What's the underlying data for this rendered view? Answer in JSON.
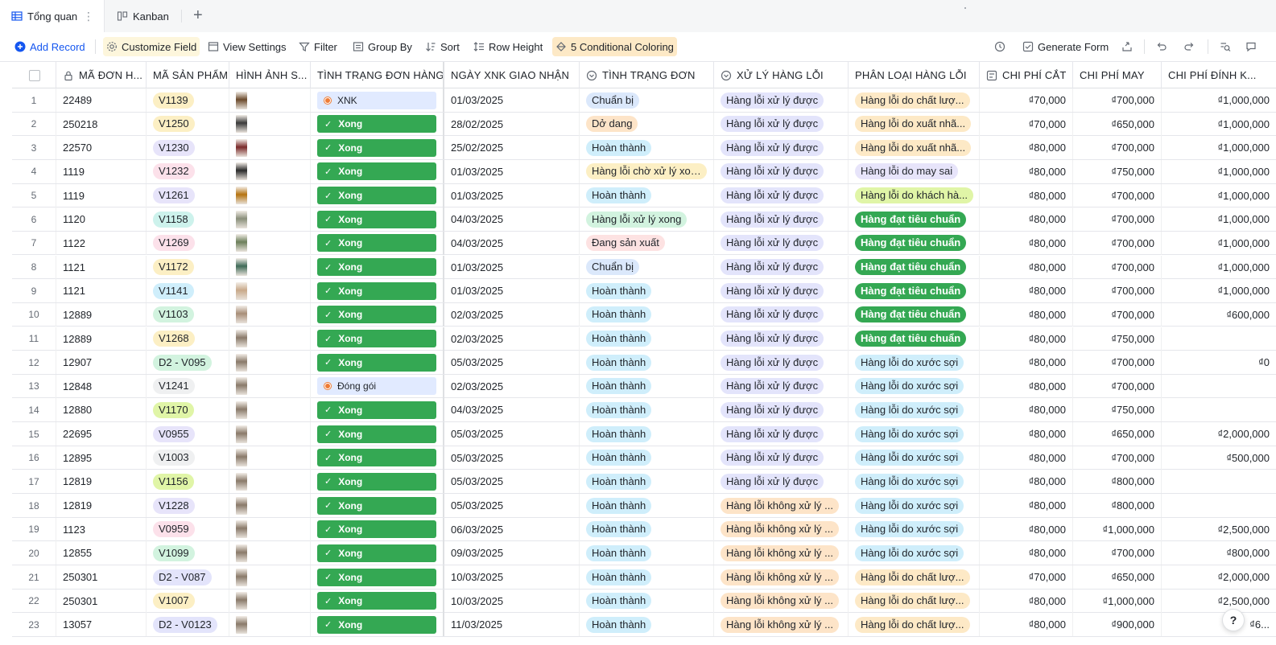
{
  "tabs": [
    {
      "label": "Tổng quan",
      "active": true
    },
    {
      "label": "Kanban",
      "active": false
    }
  ],
  "toolbar": {
    "add_record": "Add Record",
    "customize_field": "Customize Field",
    "view_settings": "View Settings",
    "filter": "Filter",
    "group_by": "Group By",
    "sort": "Sort",
    "row_height": "Row Height",
    "conditional_coloring": "5 Conditional Coloring",
    "generate_form": "Generate Form"
  },
  "columns": [
    "MÃ ĐƠN H...",
    "MÃ SẢN PHẨM",
    "HÌNH ẢNH S...",
    "TÌNH TRẠNG ĐƠN HÀNG",
    "NGÀY XNK GIAO NHẬN",
    "TÌNH TRẠNG ĐƠN",
    "XỬ LÝ HÀNG LỖI",
    "PHÂN LOẠI HÀNG LỖI",
    "CHI PHÍ CẮT",
    "CHI PHÍ MAY",
    "CHI PHÍ ĐÍNH K..."
  ],
  "colors": {
    "done_green": "#34a853",
    "accent_blue": "#1456f0"
  },
  "rows": [
    {
      "n": "1",
      "order": "22489",
      "product": "V1139",
      "pc": "#fcefc4",
      "img": "#6b4a2b",
      "status": "XNK",
      "date": "01/03/2025",
      "os": "Chuẩn bị",
      "osc": "#dbe8fb",
      "xl": "Hàng lỗi xử lý được",
      "xlc": "#e3e4fb",
      "pl": "Hàng lỗi do chất lượ...",
      "plc": "#fde9c6",
      "cut": "₫70,000",
      "sew": "₫700,000",
      "att": "₫1,000,000"
    },
    {
      "n": "2",
      "order": "250218",
      "product": "V1250",
      "pc": "#fcefc4",
      "img": "#3a3a3a",
      "status": "Xong",
      "date": "28/02/2025",
      "os": "Dở dang",
      "osc": "#fde4c8",
      "xl": "Hàng lỗi xử lý được",
      "xlc": "#e3e4fb",
      "pl": "Hàng lỗi do xuất nhã...",
      "plc": "#fde9c6",
      "cut": "₫70,000",
      "sew": "₫650,000",
      "att": "₫1,000,000"
    },
    {
      "n": "3",
      "order": "22570",
      "product": "V1230",
      "pc": "#e7e4fa",
      "img": "#7a2a2a",
      "status": "Xong",
      "date": "25/02/2025",
      "os": "Hoàn thành",
      "osc": "#cfeefb",
      "xl": "Hàng lỗi xử lý được",
      "xlc": "#e3e4fb",
      "pl": "Hàng lỗi do xuất nhã...",
      "plc": "#fde9c6",
      "cut": "₫80,000",
      "sew": "₫700,000",
      "att": "₫1,000,000"
    },
    {
      "n": "4",
      "order": "1119",
      "product": "V1232",
      "pc": "#fce1ea",
      "img": "#2a2a2a",
      "status": "Xong",
      "date": "01/03/2025",
      "os": "Hàng lỗi chờ xử lý xong",
      "osc": "#fcefc4",
      "xl": "Hàng lỗi xử lý được",
      "xlc": "#e3e4fb",
      "pl": "Hàng lỗi do may sai",
      "plc": "#e7e4fa",
      "cut": "₫80,000",
      "sew": "₫750,000",
      "att": "₫1,000,000"
    },
    {
      "n": "5",
      "order": "1119",
      "product": "V1261",
      "pc": "#e7e4fa",
      "img": "#b5730f",
      "status": "Xong",
      "date": "01/03/2025",
      "os": "Hoàn thành",
      "osc": "#cfeefb",
      "xl": "Hàng lỗi xử lý được",
      "xlc": "#e3e4fb",
      "pl": "Hàng lỗi do khách hà...",
      "plc": "#e0f5a7",
      "cut": "₫80,000",
      "sew": "₫700,000",
      "att": "₫1,000,000"
    },
    {
      "n": "6",
      "order": "1120",
      "product": "V1158",
      "pc": "#cdf2ec",
      "img": "#8a8f7a",
      "status": "Xong",
      "date": "04/03/2025",
      "os": "Hàng lỗi xử lý xong",
      "osc": "#d2f3df",
      "xl": "Hàng lỗi xử lý được",
      "xlc": "#e3e4fb",
      "pl": "Hàng đạt tiêu chuẩn",
      "plc": "done",
      "cut": "₫80,000",
      "sew": "₫700,000",
      "att": "₫1,000,000"
    },
    {
      "n": "7",
      "order": "1122",
      "product": "V1269",
      "pc": "#fce1ea",
      "img": "#6c7f5a",
      "status": "Xong",
      "date": "04/03/2025",
      "os": "Đang sản xuất",
      "osc": "#fde2e2",
      "xl": "Hàng lỗi xử lý được",
      "xlc": "#e3e4fb",
      "pl": "Hàng đạt tiêu chuẩn",
      "plc": "done",
      "cut": "₫80,000",
      "sew": "₫700,000",
      "att": "₫1,000,000"
    },
    {
      "n": "8",
      "order": "1121",
      "product": "V1172",
      "pc": "#fcefc4",
      "img": "#3f6b58",
      "status": "Xong",
      "date": "01/03/2025",
      "os": "Chuẩn bị",
      "osc": "#dbe8fb",
      "xl": "Hàng lỗi xử lý được",
      "xlc": "#e3e4fb",
      "pl": "Hàng đạt tiêu chuẩn",
      "plc": "done",
      "cut": "₫80,000",
      "sew": "₫700,000",
      "att": "₫1,000,000"
    },
    {
      "n": "9",
      "order": "1121",
      "product": "V1141",
      "pc": "#cfeefb",
      "img": "#c9a98a",
      "status": "Xong",
      "date": "01/03/2025",
      "os": "Hoàn thành",
      "osc": "#cfeefb",
      "xl": "Hàng lỗi xử lý được",
      "xlc": "#e3e4fb",
      "pl": "Hàng đạt tiêu chuẩn",
      "plc": "done",
      "cut": "₫80,000",
      "sew": "₫700,000",
      "att": "₫1,000,000"
    },
    {
      "n": "10",
      "order": "12889",
      "product": "V1103",
      "pc": "#d2f3df",
      "img": "#a88e78",
      "status": "Xong",
      "date": "02/03/2025",
      "os": "Hoàn thành",
      "osc": "#cfeefb",
      "xl": "Hàng lỗi xử lý được",
      "xlc": "#e3e4fb",
      "pl": "Hàng đạt tiêu chuẩn",
      "plc": "done",
      "cut": "₫80,000",
      "sew": "₫700,000",
      "att": "₫600,000"
    },
    {
      "n": "11",
      "order": "12889",
      "product": "V1268",
      "pc": "#fcefc4",
      "img": "#8a7a6a",
      "status": "Xong",
      "date": "02/03/2025",
      "os": "Hoàn thành",
      "osc": "#cfeefb",
      "xl": "Hàng lỗi xử lý được",
      "xlc": "#e3e4fb",
      "pl": "Hàng đạt tiêu chuẩn",
      "plc": "done",
      "cut": "₫80,000",
      "sew": "₫750,000",
      "att": ""
    },
    {
      "n": "12",
      "order": "12907",
      "product": "D2 - V095",
      "pc": "#d2f3df",
      "img": "#8a7a6a",
      "status": "Xong",
      "date": "05/03/2025",
      "os": "Hoàn thành",
      "osc": "#cfeefb",
      "xl": "Hàng lỗi xử lý được",
      "xlc": "#e3e4fb",
      "pl": "Hàng lỗi do xước sợi",
      "plc": "#cfeefb",
      "cut": "₫80,000",
      "sew": "₫700,000",
      "att": "₫0"
    },
    {
      "n": "13",
      "order": "12848",
      "product": "V1241",
      "pc": "#eff0f1",
      "img": "#8a7a6a",
      "status": "Đóng gói",
      "date": "02/03/2025",
      "os": "Hoàn thành",
      "osc": "#cfeefb",
      "xl": "Hàng lỗi xử lý được",
      "xlc": "#e3e4fb",
      "pl": "Hàng lỗi do xước sợi",
      "plc": "#cfeefb",
      "cut": "₫80,000",
      "sew": "₫700,000",
      "att": ""
    },
    {
      "n": "14",
      "order": "12880",
      "product": "V1170",
      "pc": "#e0f5a7",
      "img": "#8a7a6a",
      "status": "Xong",
      "date": "04/03/2025",
      "os": "Hoàn thành",
      "osc": "#cfeefb",
      "xl": "Hàng lỗi xử lý được",
      "xlc": "#e3e4fb",
      "pl": "Hàng lỗi do xước sợi",
      "plc": "#cfeefb",
      "cut": "₫80,000",
      "sew": "₫750,000",
      "att": ""
    },
    {
      "n": "15",
      "order": "22695",
      "product": "V0955",
      "pc": "#e7e4fa",
      "img": "#8a7a6a",
      "status": "Xong",
      "date": "05/03/2025",
      "os": "Hoàn thành",
      "osc": "#cfeefb",
      "xl": "Hàng lỗi xử lý được",
      "xlc": "#e3e4fb",
      "pl": "Hàng lỗi do xước sợi",
      "plc": "#cfeefb",
      "cut": "₫80,000",
      "sew": "₫650,000",
      "att": "₫2,000,000"
    },
    {
      "n": "16",
      "order": "12895",
      "product": "V1003",
      "pc": "#eff0f1",
      "img": "#8a7a6a",
      "status": "Xong",
      "date": "05/03/2025",
      "os": "Hoàn thành",
      "osc": "#cfeefb",
      "xl": "Hàng lỗi xử lý được",
      "xlc": "#e3e4fb",
      "pl": "Hàng lỗi do xước sợi",
      "plc": "#cfeefb",
      "cut": "₫80,000",
      "sew": "₫700,000",
      "att": "₫500,000"
    },
    {
      "n": "17",
      "order": "12819",
      "product": "V1156",
      "pc": "#e0f5a7",
      "img": "#8a7a6a",
      "status": "Xong",
      "date": "05/03/2025",
      "os": "Hoàn thành",
      "osc": "#cfeefb",
      "xl": "Hàng lỗi xử lý được",
      "xlc": "#e3e4fb",
      "pl": "Hàng lỗi do xước sợi",
      "plc": "#cfeefb",
      "cut": "₫80,000",
      "sew": "₫800,000",
      "att": ""
    },
    {
      "n": "18",
      "order": "12819",
      "product": "V1228",
      "pc": "#e7e4fa",
      "img": "#8a7a6a",
      "status": "Xong",
      "date": "05/03/2025",
      "os": "Hoàn thành",
      "osc": "#cfeefb",
      "xl": "Hàng lỗi không xử lý ...",
      "xlc": "#fde4c8",
      "pl": "Hàng lỗi do xước sợi",
      "plc": "#cfeefb",
      "cut": "₫80,000",
      "sew": "₫800,000",
      "att": ""
    },
    {
      "n": "19",
      "order": "1123",
      "product": "V0959",
      "pc": "#fce1ea",
      "img": "#8a7a6a",
      "status": "Xong",
      "date": "06/03/2025",
      "os": "Hoàn thành",
      "osc": "#cfeefb",
      "xl": "Hàng lỗi không xử lý ...",
      "xlc": "#fde4c8",
      "pl": "Hàng lỗi do xước sợi",
      "plc": "#cfeefb",
      "cut": "₫80,000",
      "sew": "₫1,000,000",
      "att": "₫2,500,000"
    },
    {
      "n": "20",
      "order": "12855",
      "product": "V1099",
      "pc": "#d2f3df",
      "img": "#8a7a6a",
      "status": "Xong",
      "date": "09/03/2025",
      "os": "Hoàn thành",
      "osc": "#cfeefb",
      "xl": "Hàng lỗi không xử lý ...",
      "xlc": "#fde4c8",
      "pl": "Hàng lỗi do xước sợi",
      "plc": "#cfeefb",
      "cut": "₫80,000",
      "sew": "₫700,000",
      "att": "₫800,000"
    },
    {
      "n": "21",
      "order": "250301",
      "product": "D2 - V087",
      "pc": "#e3e4fb",
      "img": "#8a7a6a",
      "status": "Xong",
      "date": "10/03/2025",
      "os": "Hoàn thành",
      "osc": "#cfeefb",
      "xl": "Hàng lỗi không xử lý ...",
      "xlc": "#fde4c8",
      "pl": "Hàng lỗi do chất lượ...",
      "plc": "#fde9c6",
      "cut": "₫70,000",
      "sew": "₫650,000",
      "att": "₫2,000,000"
    },
    {
      "n": "22",
      "order": "250301",
      "product": "V1007",
      "pc": "#fcefc4",
      "img": "#8a7a6a",
      "status": "Xong",
      "date": "10/03/2025",
      "os": "Hoàn thành",
      "osc": "#cfeefb",
      "xl": "Hàng lỗi không xử lý ...",
      "xlc": "#fde4c8",
      "pl": "Hàng lỗi do chất lượ...",
      "plc": "#fde9c6",
      "cut": "₫80,000",
      "sew": "₫1,000,000",
      "att": "₫2,500,000"
    },
    {
      "n": "23",
      "order": "13057",
      "product": "D2 - V0123",
      "pc": "#e3e4fb",
      "img": "#8a7a6a",
      "status": "Xong",
      "date": "11/03/2025",
      "os": "Hoàn thành",
      "osc": "#cfeefb",
      "xl": "Hàng lỗi không xử lý ...",
      "xlc": "#fde4c8",
      "pl": "Hàng lỗi do chất lượ...",
      "plc": "#fde9c6",
      "cut": "₫80,000",
      "sew": "₫900,000",
      "att": "₫6..."
    }
  ],
  "help_label": "?"
}
